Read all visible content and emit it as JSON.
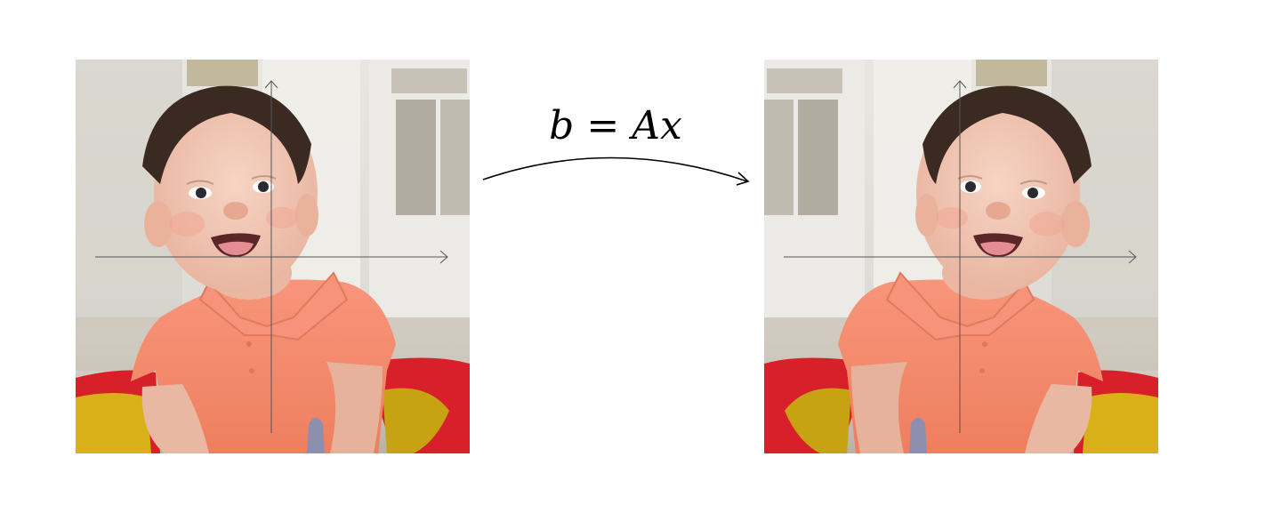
{
  "equation": {
    "lhs": "b",
    "equals": "=",
    "matrix": "A",
    "vector": "x"
  },
  "images": [
    {
      "role": "original",
      "content": "baby-photo"
    },
    {
      "role": "transformed",
      "content": "baby-photo",
      "transform": "horizontal-reflection"
    }
  ],
  "colors": {
    "background": "#ffffff",
    "shirt": "#f48a6a",
    "seat_red": "#d7202a",
    "seat_yellow": "#d8b018",
    "axis": "#555555"
  }
}
